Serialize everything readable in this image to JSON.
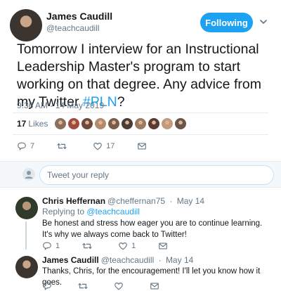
{
  "tweet": {
    "author_name": "James Caudill",
    "author_handle": "@teachcaudill",
    "follow_label": "Following",
    "text_prefix": "Tomorrow I interview for an Instructional Leadership Master's program to start working on that degree. Any advice from my Twitter ",
    "hashtag": "#PLN",
    "text_suffix": "?",
    "timestamp": "9:36 AM - 14 May 2019",
    "likes_count": "17",
    "likes_label": "Likes",
    "liker_colors": [
      "#8b6f5c",
      "#a24b3d",
      "#6e4a3a",
      "#b48a6d",
      "#7a5c48",
      "#4a3b35",
      "#9c7b63",
      "#5b3a31",
      "#c29a7c",
      "#6b5448"
    ],
    "actions": {
      "replies": "7",
      "retweets": "",
      "likes": "17"
    }
  },
  "reply_box": {
    "placeholder": "Tweet your reply"
  },
  "replies": [
    {
      "name": "Chris Heffernan",
      "handle": "@cheffernan75",
      "date": "May 14",
      "replying_to_label": "Replying to",
      "replying_to": "@teachcaudill",
      "text": "Be honest and stress how eager you are to continue learning. It's why we always come back to Twitter!",
      "counts": {
        "replies": "1",
        "retweets": "",
        "likes": "1"
      }
    },
    {
      "name": "James Caudill",
      "handle": "@teachcaudill",
      "date": "May 14",
      "text": "Thanks, Chris, for the encouragement! I'll let you know how it goes.",
      "counts": {
        "replies": "",
        "retweets": "",
        "likes": ""
      }
    }
  ]
}
